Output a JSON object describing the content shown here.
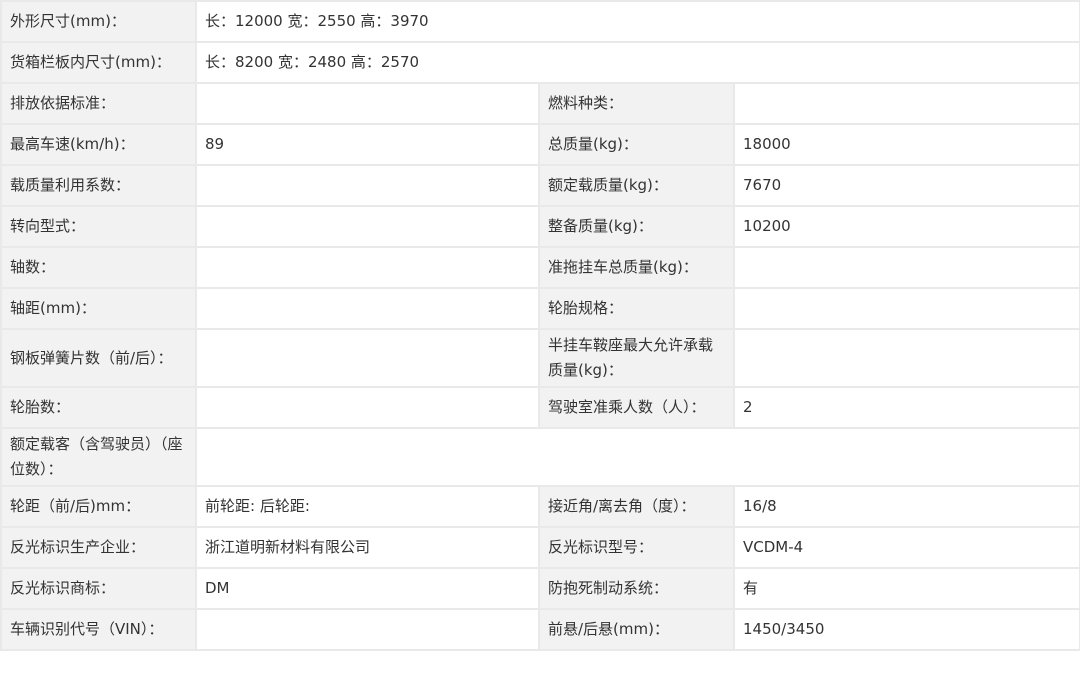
{
  "rows": [
    {
      "type": "full",
      "label": "外形尺寸(mm)：",
      "value": "长：12000 宽：2550 高：3970"
    },
    {
      "type": "full",
      "label": "货箱栏板内尺寸(mm)：",
      "value": "长：8200 宽：2480 高：2570"
    },
    {
      "type": "pair",
      "l1": "排放依据标准：",
      "v1": "",
      "l2": "燃料种类：",
      "v2": ""
    },
    {
      "type": "pair",
      "l1": "最高车速(km/h)：",
      "v1": "89",
      "l2": "总质量(kg)：",
      "v2": "18000"
    },
    {
      "type": "pair",
      "l1": "载质量利用系数：",
      "v1": "",
      "l2": "额定载质量(kg)：",
      "v2": "7670"
    },
    {
      "type": "pair",
      "l1": "转向型式：",
      "v1": "",
      "l2": "整备质量(kg)：",
      "v2": "10200"
    },
    {
      "type": "pair",
      "l1": "轴数：",
      "v1": "",
      "l2": "准拖挂车总质量(kg)：",
      "v2": ""
    },
    {
      "type": "pair",
      "l1": "轴距(mm)：",
      "v1": "",
      "l2": "轮胎规格：",
      "v2": ""
    },
    {
      "type": "pair",
      "l1": "钢板弹簧片数（前/后）：",
      "v1": "",
      "l2": "半挂车鞍座最大允许承载质量(kg)：",
      "v2": ""
    },
    {
      "type": "pair",
      "l1": "轮胎数：",
      "v1": "",
      "l2": "驾驶室准乘人数（人）：",
      "v2": "2"
    },
    {
      "type": "full",
      "label": "额定载客（含驾驶员）（座位数）：",
      "value": ""
    },
    {
      "type": "pair",
      "l1": "轮距（前/后)mm：",
      "v1": "前轮距: 后轮距:",
      "l2": "接近角/离去角（度）：",
      "v2": "16/8"
    },
    {
      "type": "pair",
      "l1": "反光标识生产企业：",
      "v1": "浙江道明新材料有限公司",
      "l2": "反光标识型号：",
      "v2": "VCDM-4"
    },
    {
      "type": "pair",
      "l1": "反光标识商标：",
      "v1": "DM",
      "l2": "防抱死制动系统：",
      "v2": "有"
    },
    {
      "type": "pair",
      "l1": "车辆识别代号（VIN）：",
      "v1": "",
      "l2": "前悬/后悬(mm)：",
      "v2": "1450/3450"
    }
  ]
}
